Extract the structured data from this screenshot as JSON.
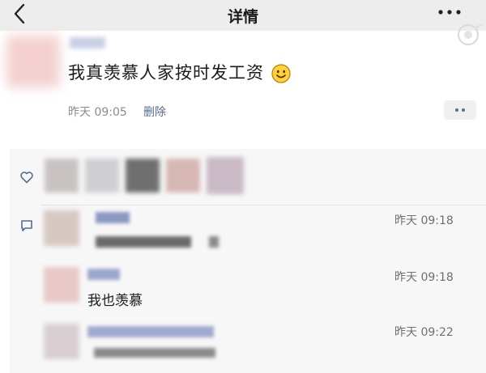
{
  "nav": {
    "title": "详情"
  },
  "post": {
    "text": "我真羡慕人家按时发工资",
    "time": "昨天 09:05",
    "delete_label": "删除"
  },
  "comments": [
    {
      "time": "昨天 09:18",
      "text": ""
    },
    {
      "time": "昨天 09:18",
      "text": "我也羡慕"
    },
    {
      "time": "昨天 09:22",
      "text": ""
    }
  ],
  "colors": {
    "nav_bg": "#ededed",
    "link": "#576b95",
    "panel_bg": "#f7f7f7",
    "meta_gray": "#8b8b8b"
  },
  "icons": [
    "back-icon",
    "more-icon",
    "heart-icon",
    "comment-icon",
    "smile-emoji-icon"
  ]
}
